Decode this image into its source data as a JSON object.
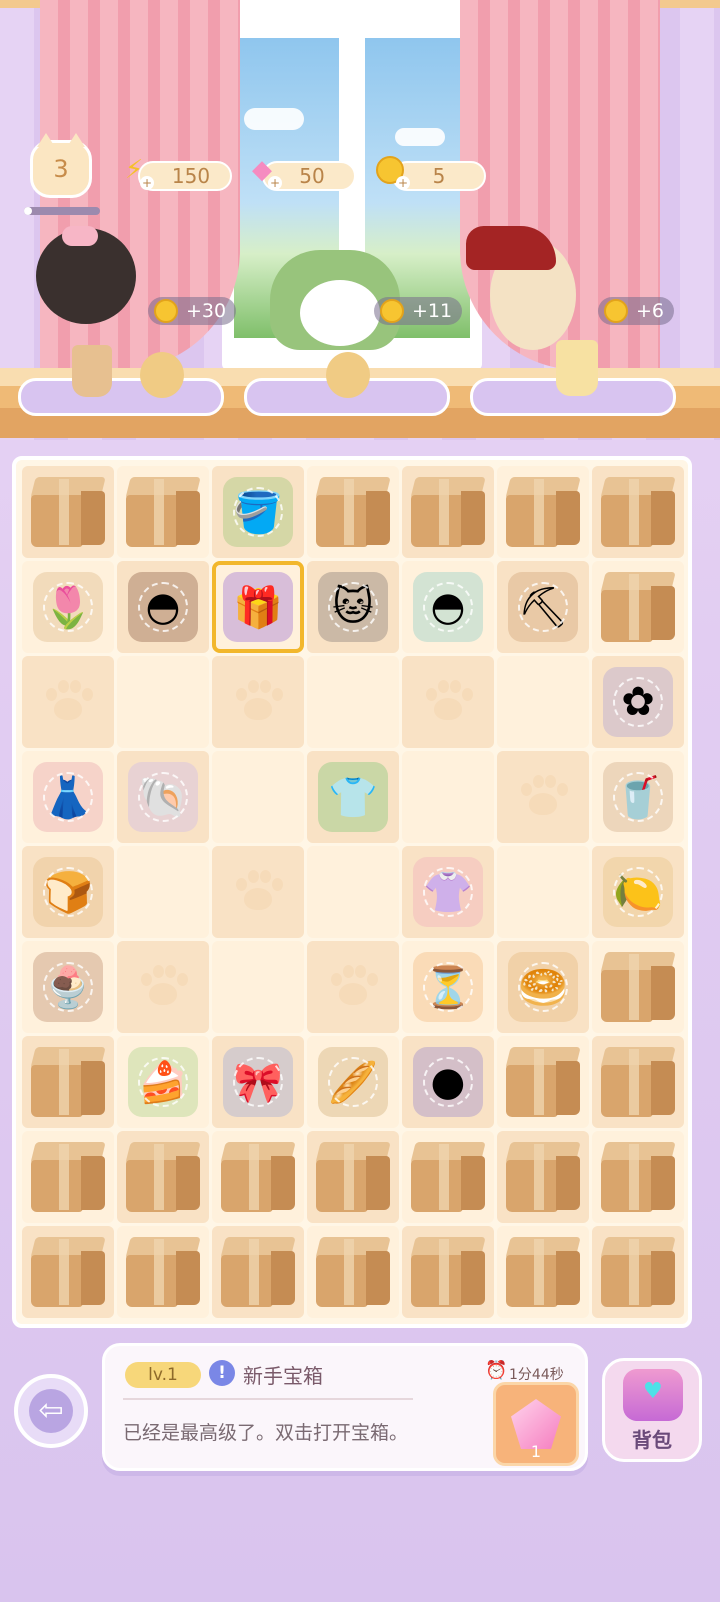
{
  "hud": {
    "level": "3",
    "xp_fraction": 0.1,
    "energy": "150",
    "gems": "50",
    "coins": "5"
  },
  "customers": [
    {
      "reward": "+30"
    },
    {
      "reward": "+11"
    },
    {
      "reward": "+6"
    }
  ],
  "board": {
    "rows": [
      [
        "box",
        "box",
        "watering-can",
        "box",
        "box",
        "box",
        "box"
      ],
      [
        "tulip",
        "bowl",
        "gift",
        "cat-plush",
        "teal-bowl",
        "shovel",
        "box"
      ],
      [
        "paw",
        "empty",
        "paw",
        "empty",
        "paw",
        "empty",
        "lavender"
      ],
      [
        "dress",
        "pearl-shell",
        "empty",
        "sweater",
        "empty",
        "paw",
        "iced-drink"
      ],
      [
        "cat-bread",
        "empty",
        "paw",
        "empty",
        "pink-clothes",
        "empty",
        "lemon-drink"
      ],
      [
        "parfait",
        "paw",
        "empty",
        "paw",
        "hourglass",
        "cream-bun",
        "box"
      ],
      [
        "box",
        "cake",
        "ribbon",
        "bread-loaf",
        "purple-cushion",
        "box",
        "box"
      ],
      [
        "box",
        "box",
        "box",
        "box",
        "box",
        "box",
        "box"
      ],
      [
        "box",
        "box",
        "box",
        "box",
        "box",
        "box",
        "box"
      ]
    ]
  },
  "info_panel": {
    "level_tag": "lv.1",
    "item_name": "新手宝箱",
    "description": "已经是最高级了。双击打开宝箱。",
    "timer": "1分44秒",
    "gem_cost": "1"
  },
  "bag_label": "背包"
}
